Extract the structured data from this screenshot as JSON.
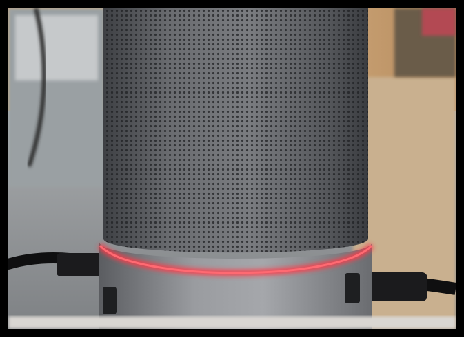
{
  "scene": {
    "subject": "smart-speaker",
    "colors": {
      "background_wood": "#b58a5c",
      "background_wall": "#c7b59d",
      "desk_surface": "#8f9294",
      "speaker_body": "#5d5f63",
      "speaker_base": "#8c8e92",
      "led_ring": "#ff3b4a",
      "cable": "#111111"
    },
    "led_ring": {
      "state": "on",
      "color": "red"
    }
  }
}
